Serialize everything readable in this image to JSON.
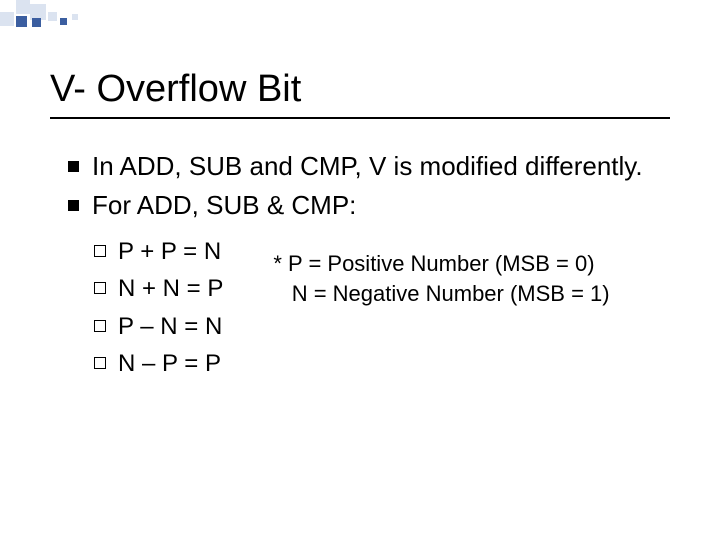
{
  "title": "V- Overflow Bit",
  "bullets": {
    "b1": "In ADD, SUB and CMP, V is modified differently.",
    "b2": "For ADD, SUB & CMP:"
  },
  "sub": {
    "s1": "P + P = N",
    "s2": "N + N = P",
    "s3": "P – N = N",
    "s4": "N – P = P"
  },
  "note": "* P = Positive Number (MSB = 0)\n   N = Negative Number (MSB = 1)"
}
